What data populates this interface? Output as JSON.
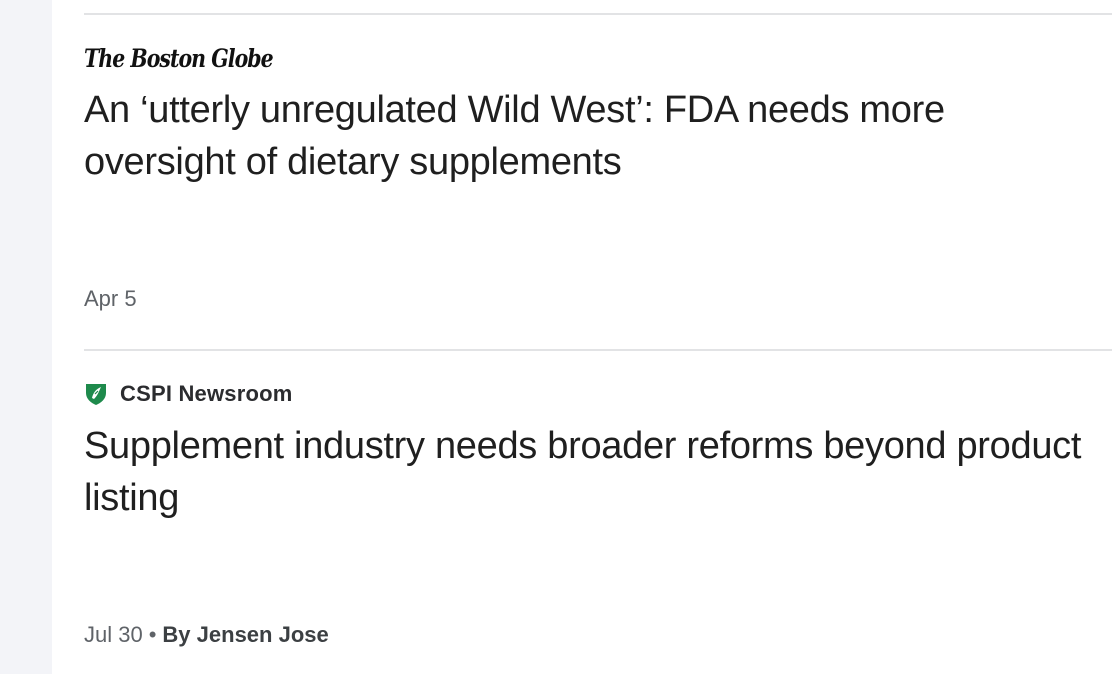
{
  "articles": [
    {
      "source": "The Boston Globe",
      "source_style": "blackletter-logo",
      "headline": "An ‘utterly unregulated Wild West’: FDA needs more oversight of dietary supplements",
      "date": "Apr 5"
    },
    {
      "source": "CSPI Newsroom",
      "source_icon": "cspi-shield-icon",
      "headline": "Supplement industry needs broader reforms beyond product listing",
      "date": "Jul 30",
      "separator": "•",
      "author": "By Jensen Jose"
    }
  ],
  "colors": {
    "rail": "#f3f4f8",
    "divider": "#e2e3e5",
    "cspi_green": "#1e8a4c"
  }
}
